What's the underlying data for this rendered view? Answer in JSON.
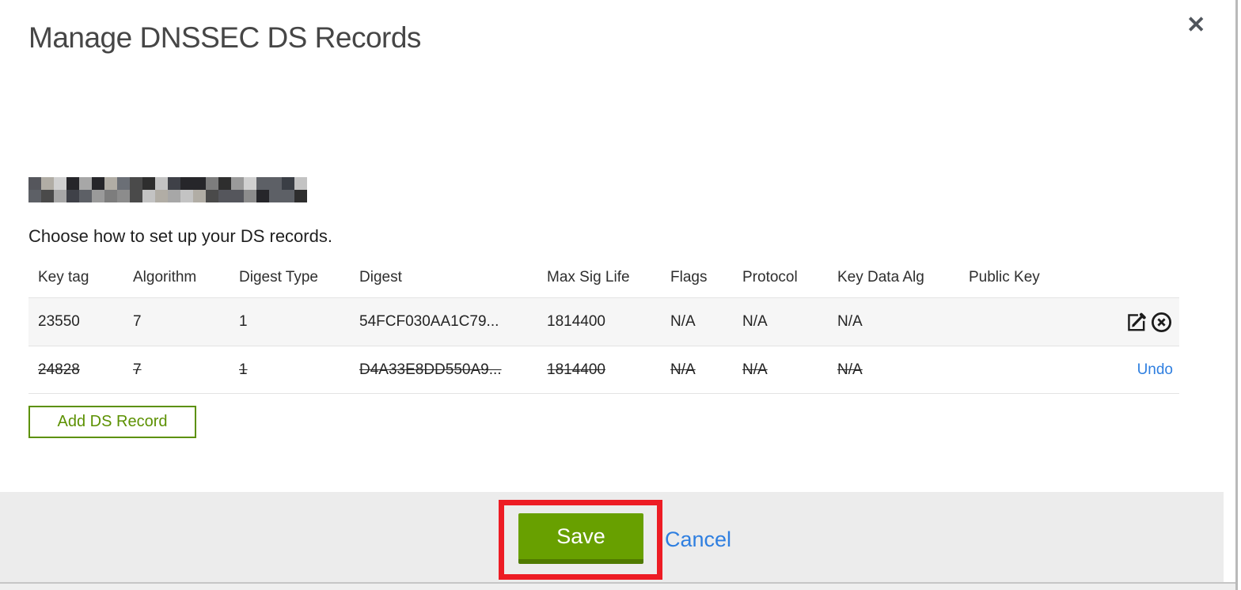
{
  "modal": {
    "title": "Manage DNSSEC DS Records",
    "close_glyph": "✕",
    "subtitle": "Choose how to set up your DS records.",
    "domain_redacted": true
  },
  "table": {
    "headers": [
      "Key tag",
      "Algorithm",
      "Digest Type",
      "Digest",
      "Max Sig Life",
      "Flags",
      "Protocol",
      "Key Data Alg",
      "Public Key"
    ],
    "rows": [
      {
        "key_tag": "23550",
        "algorithm": "7",
        "digest_type": "1",
        "digest": "54FCF030AA1C79...",
        "max_sig_life": "1814400",
        "flags": "N/A",
        "protocol": "N/A",
        "key_data_alg": "N/A",
        "public_key": "",
        "deleted": false
      },
      {
        "key_tag": "24828",
        "algorithm": "7",
        "digest_type": "1",
        "digest": "D4A33E8DD550A9...",
        "max_sig_life": "1814400",
        "flags": "N/A",
        "protocol": "N/A",
        "key_data_alg": "N/A",
        "public_key": "",
        "deleted": true,
        "undo_label": "Undo"
      }
    ]
  },
  "buttons": {
    "add_ds_record": "Add DS Record",
    "save": "Save",
    "cancel": "Cancel"
  },
  "colors": {
    "save_green": "#68a000",
    "save_green_dark": "#4f7a00",
    "outline_green": "#5c9102",
    "link_blue": "#2f7fe0",
    "annotation_red": "#ed1c24",
    "footer_gray": "#ececec",
    "row_stripe_gray": "#f6f6f6"
  }
}
